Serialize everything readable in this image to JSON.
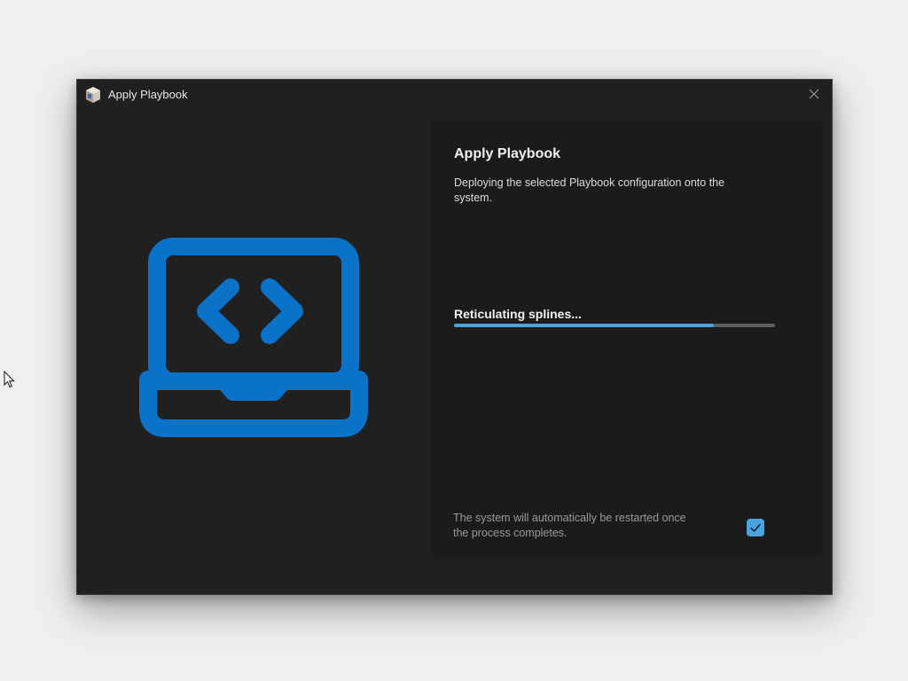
{
  "window": {
    "title": "Apply Playbook",
    "app_icon": "playbook-app-icon",
    "close_icon": "close-icon"
  },
  "hero": {
    "icon": "laptop-code-icon",
    "color": "#0b72c9"
  },
  "panel": {
    "title": "Apply Playbook",
    "description": "Deploying the selected Playbook configuration onto the system.",
    "status": "Reticulating splines...",
    "progress_percent": 81,
    "restart_note": "The system will automatically be restarted once the process completes.",
    "restart_checked": true
  },
  "colors": {
    "accent": "#4aa3df",
    "window_bg": "#202020",
    "panel_bg": "#1b1b1b"
  }
}
